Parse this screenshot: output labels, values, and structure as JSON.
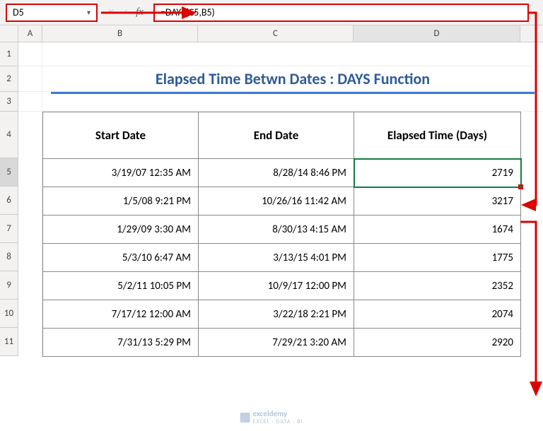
{
  "nameBox": {
    "value": "D5"
  },
  "formulaBar": {
    "formula": "=DAYS(C5,B5)",
    "fxLabel": "fx"
  },
  "columns": {
    "a": "A",
    "b": "B",
    "c": "C",
    "d": "D"
  },
  "rowLabels": [
    "1",
    "2",
    "3",
    "4",
    "5",
    "6",
    "7",
    "8",
    "9",
    "10",
    "11"
  ],
  "title": "Elapsed Time Betwn Dates : DAYS Function",
  "headers": {
    "start": "Start Date",
    "end": "End Date",
    "elapsed": "Elapsed Time (Days)"
  },
  "rows": [
    {
      "start": "3/19/07 12:35 AM",
      "end": "8/28/14 8:46 PM",
      "days": "2719"
    },
    {
      "start": "1/5/08 9:21 PM",
      "end": "10/26/16 11:42 AM",
      "days": "3217"
    },
    {
      "start": "1/29/09 3:30 AM",
      "end": "8/30/13 4:15 AM",
      "days": "1674"
    },
    {
      "start": "5/3/10 6:47 AM",
      "end": "3/13/15 4:01 PM",
      "days": "1775"
    },
    {
      "start": "5/2/11 10:05 PM",
      "end": "10/9/17 12:00 PM",
      "days": "2352"
    },
    {
      "start": "7/17/12 12:00 AM",
      "end": "3/22/18 2:21 PM",
      "days": "2074"
    },
    {
      "start": "7/31/13 5:29 PM",
      "end": "7/29/21 3:20 AM",
      "days": "2920"
    }
  ],
  "watermark": {
    "brand": "exceldemy",
    "tag": "EXCEL · DATA · BI"
  },
  "colors": {
    "highlight": "#d00",
    "selection": "#107c41",
    "titleText": "#2e5b9a",
    "titleUnderline": "#3d7ad6"
  }
}
